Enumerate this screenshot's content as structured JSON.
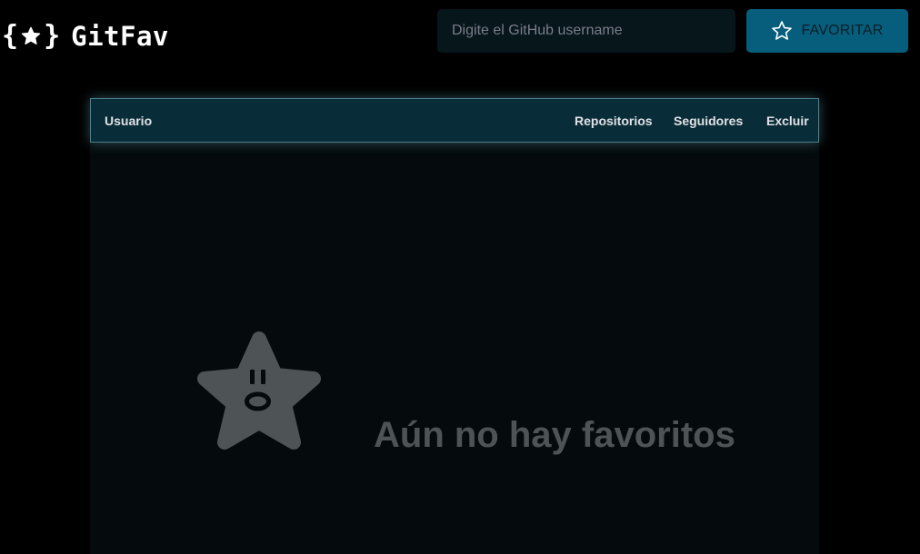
{
  "header": {
    "logo_open_brace": "{",
    "logo_close_brace": "}",
    "logo_text": "GitFav",
    "logo_icon": "star-icon",
    "search_placeholder": "Digite el GitHub username",
    "search_value": "",
    "favorite_button_label": "FAVORITAR",
    "favorite_button_icon": "star-outline-icon"
  },
  "table": {
    "columns": [
      "Usuario",
      "Repositorios",
      "Seguidores",
      "Excluir"
    ],
    "rows": []
  },
  "empty_state": {
    "icon": "surprised-star-icon",
    "message": "Aún no hay favoritos"
  },
  "colors": {
    "background": "#000000",
    "accent": "#065e7c",
    "table_header": "#092d38",
    "panel": "#050b0d",
    "muted_text": "#4e5455"
  }
}
